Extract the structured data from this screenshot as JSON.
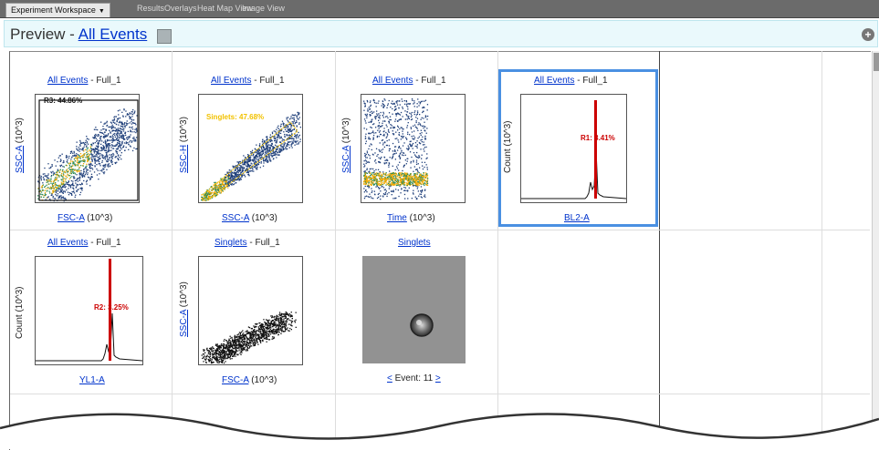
{
  "tabs": [
    {
      "label": "Experiment Workspace",
      "active": true
    },
    {
      "label": "Results",
      "active": false
    },
    {
      "label": "Overlays",
      "active": false
    },
    {
      "label": "Heat Map View",
      "active": false
    },
    {
      "label": "Image View",
      "active": false
    }
  ],
  "header": {
    "prefix": "Preview - ",
    "link": "All Events"
  },
  "colors": {
    "accent_link": "#0033cc",
    "selection": "#4a90e2",
    "gate_red": "#cc0000",
    "gate_yellow": "#f2c200"
  },
  "plots": [
    {
      "title_link": "All Events",
      "title_rest": " - Full_1",
      "xlabel_link": "FSC-A",
      "xlabel_rest": " (10^3)",
      "ylabel_link": "SSC-A",
      "ylabel_rest": " (10^3)",
      "gate": "R3: 44.86%"
    },
    {
      "title_link": "All Events",
      "title_rest": " - Full_1",
      "xlabel_link": "SSC-A",
      "xlabel_rest": " (10^3)",
      "ylabel_link": "SSC-H",
      "ylabel_rest": " (10^3)",
      "gate": "Singlets: 47.68%"
    },
    {
      "title_link": "All Events",
      "title_rest": " - Full_1",
      "xlabel_link": "Time",
      "xlabel_rest": " (10^3)",
      "ylabel_link": "SSC-A",
      "ylabel_rest": " (10^3)",
      "gate": ""
    },
    {
      "title_link": "All Events",
      "title_rest": " - Full_1",
      "xlabel_link": "BL2-A",
      "xlabel_rest": "",
      "ylabel_link": "",
      "ylabel_rest": "Count (10^3)",
      "gate": "R1: 3.41%"
    },
    {
      "title_link": "All Events",
      "title_rest": " - Full_1",
      "xlabel_link": "YL1-A",
      "xlabel_rest": "",
      "ylabel_link": "",
      "ylabel_rest": "Count (10^3)",
      "gate": "R2: 3.25%"
    },
    {
      "title_link": "Singlets",
      "title_rest": " - Full_1",
      "xlabel_link": "FSC-A",
      "xlabel_rest": " (10^3)",
      "ylabel_link": "SSC-A",
      "ylabel_rest": " (10^3)",
      "gate": ""
    }
  ],
  "image_cell": {
    "title": "Singlets",
    "prev": "<",
    "event_label": " Event: 11 ",
    "next": ">"
  },
  "icons": {
    "dropdown": "caret-down-icon",
    "add": "plus-icon",
    "color_swatch": "swatch-icon"
  }
}
